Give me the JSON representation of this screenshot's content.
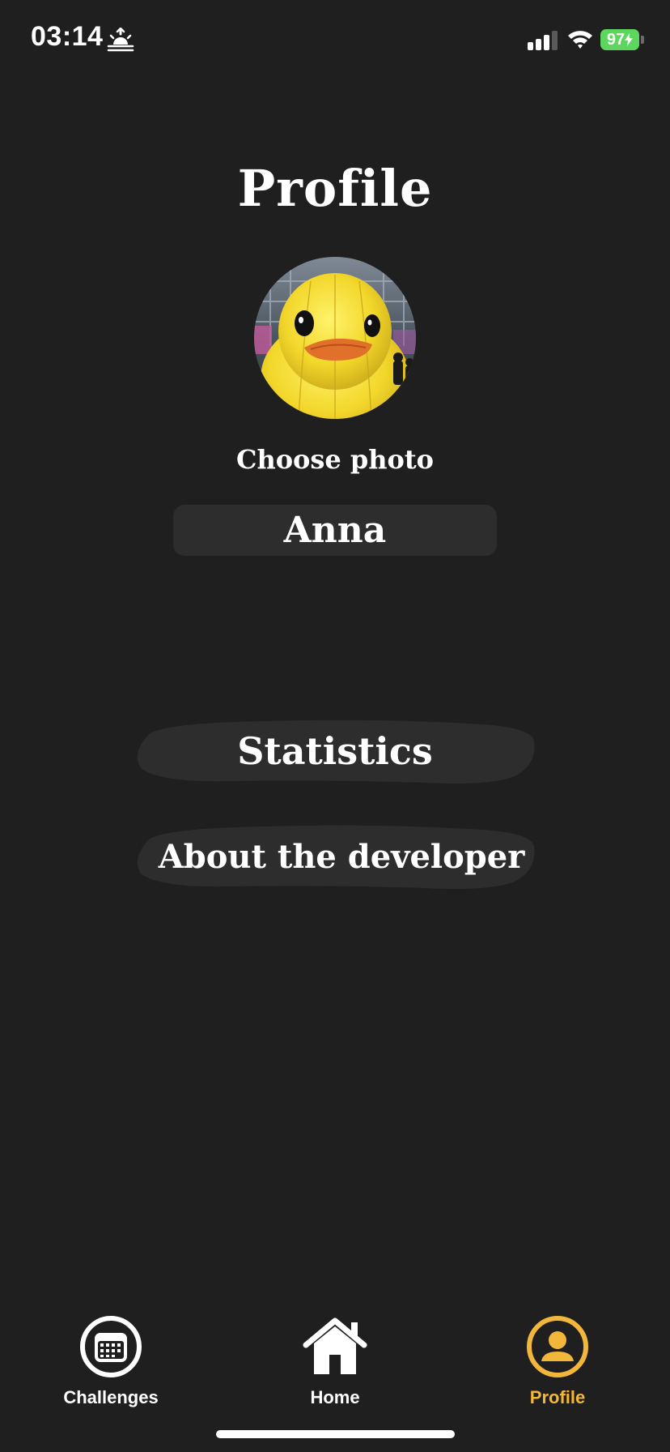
{
  "status_bar": {
    "time": "03:14",
    "battery_percent": "97"
  },
  "title": "Profile",
  "avatar": {
    "icon": "rubber-duck-photo"
  },
  "choose_photo_label": "Choose photo",
  "name_field": {
    "value": "Anna"
  },
  "buttons": {
    "statistics": "Statistics",
    "about_developer": "About the developer"
  },
  "tab_bar": {
    "active": "Profile",
    "accent_color": "#f2b73a",
    "items": [
      {
        "label": "Challenges",
        "icon": "calendar-icon"
      },
      {
        "label": "Home",
        "icon": "home-icon"
      },
      {
        "label": "Profile",
        "icon": "person-icon"
      }
    ]
  }
}
